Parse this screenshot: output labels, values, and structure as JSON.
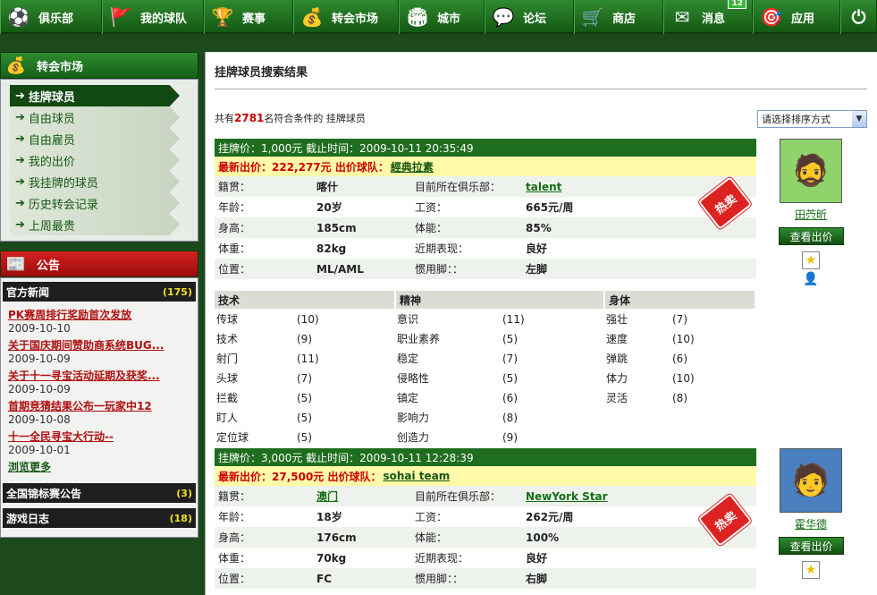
{
  "nav": [
    {
      "label": "俱乐部",
      "icon": "⚽"
    },
    {
      "label": "我的球队",
      "icon": "🚩"
    },
    {
      "label": "赛事",
      "icon": "🏆"
    },
    {
      "label": "转会市场",
      "icon": "💰"
    },
    {
      "label": "城市",
      "icon": "🏟"
    },
    {
      "label": "论坛",
      "icon": "💬"
    },
    {
      "label": "商店",
      "icon": "🛒"
    },
    {
      "label": "消息",
      "icon": "✉",
      "badge": "12"
    },
    {
      "label": "应用",
      "icon": "🎯"
    },
    {
      "label": "",
      "icon": "⏻"
    }
  ],
  "sidebar": {
    "market_title": "转会市场",
    "menu": [
      {
        "label": "挂牌球员"
      },
      {
        "label": "自由球员"
      },
      {
        "label": "自由雇员"
      },
      {
        "label": "我的出价"
      },
      {
        "label": "我挂牌的球员"
      },
      {
        "label": "历史转会记录"
      },
      {
        "label": "上周最贵"
      }
    ],
    "notice_title": "公告",
    "official_news": "官方新闻",
    "official_count": "(175)",
    "news": [
      {
        "title": "PK赛周排行奖励首次发放",
        "date": "2009-10-10"
      },
      {
        "title": "关于国庆期间赞助商系统BUG...",
        "date": "2009-10-09"
      },
      {
        "title": "关于十一寻宝活动延期及获奖...",
        "date": "2009-10-09"
      },
      {
        "title": "首期竞猜结果公布一玩家中12",
        "date": "2009-10-08"
      },
      {
        "title": "十一全民寻宝大行动--",
        "date": "2009-10-01"
      }
    ],
    "more": "浏览更多",
    "tournament": "全国锦标赛公告",
    "tournament_count": "(3)",
    "gamelog": "游戏日志",
    "gamelog_count": "(18)"
  },
  "main": {
    "title": "挂牌球员搜索结果",
    "count_prefix": "共有",
    "count": "2781",
    "count_suffix": "名符合条件的 挂牌球员",
    "sort_label": "请选择排序方式",
    "hot_label": "热卖",
    "bid_button": "查看出价",
    "labels": {
      "nat": "籍贯：",
      "club": "目前所在俱乐部：",
      "age": "年龄：",
      "wage": "工资：",
      "height": "身高：",
      "fitness": "体能：",
      "weight": "体重：",
      "form": "近期表现：",
      "pos": "位置：",
      "foot": "惯用脚：："
    },
    "listings": [
      {
        "header": "挂牌价：1,000元  截止时间：2009-10-11 20:35:49",
        "bid_prefix": "最新出价：222,277元  出价球队：",
        "bid_team": "經典拉素",
        "nat": "喀什",
        "club": "talent",
        "age": "20岁",
        "wage": "665元/周",
        "height": "185cm",
        "fitness": "85%",
        "weight": "82kg",
        "form": "良好",
        "pos": "ML/AML",
        "foot": "左脚",
        "name": "田茓昕",
        "avatar": "🧔"
      },
      {
        "header": "挂牌价：3,000元  截止时间：2009-10-11 12:28:39",
        "bid_prefix": "最新出价：27,500元  出价球队：",
        "bid_team": "sohai team",
        "nat": "澳门",
        "club": "NewYork Star",
        "age": "18岁",
        "wage": "262元/周",
        "height": "176cm",
        "fitness": "100%",
        "weight": "70kg",
        "form": "良好",
        "pos": "FC",
        "foot": "右脚",
        "name": "霍华德",
        "avatar": "🧑"
      }
    ],
    "skills": {
      "heads": [
        "技术",
        "精神",
        "身体"
      ],
      "rows": [
        [
          [
            "传球",
            "(10)"
          ],
          [
            "意识",
            "(11)"
          ],
          [
            "强壮",
            "(7)"
          ]
        ],
        [
          [
            "技术",
            "(9)"
          ],
          [
            "职业素养",
            "(5)"
          ],
          [
            "速度",
            "(10)"
          ]
        ],
        [
          [
            "射门",
            "(11)"
          ],
          [
            "稳定",
            "(7)"
          ],
          [
            "弹跳",
            "(6)"
          ]
        ],
        [
          [
            "头球",
            "(7)"
          ],
          [
            "侵略性",
            "(5)"
          ],
          [
            "体力",
            "(10)"
          ]
        ],
        [
          [
            "拦截",
            "(5)"
          ],
          [
            "镇定",
            "(6)"
          ],
          [
            "灵活",
            "(8)"
          ]
        ],
        [
          [
            "盯人",
            "(5)"
          ],
          [
            "影响力",
            "(8)"
          ],
          [
            "",
            ""
          ]
        ],
        [
          [
            "定位球",
            "(5)"
          ],
          [
            "创造力",
            "(9)"
          ],
          [
            "",
            ""
          ]
        ]
      ]
    }
  }
}
